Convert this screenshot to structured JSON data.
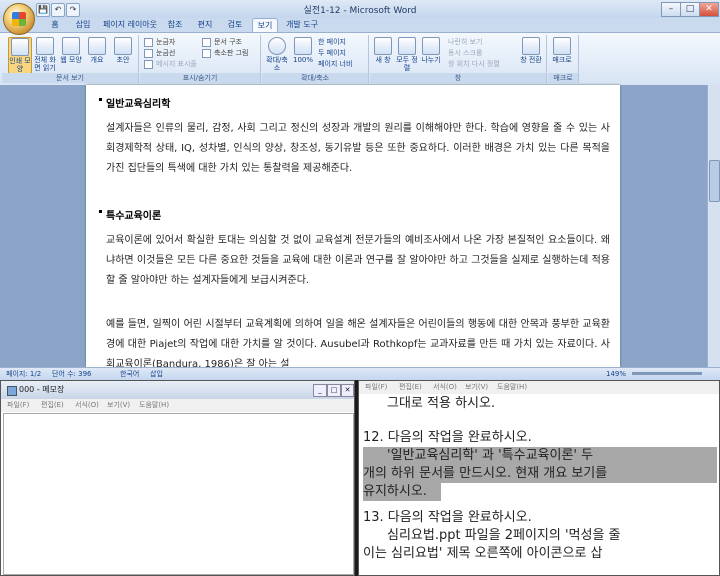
{
  "word": {
    "title": "실전1-12 - Microsoft Word",
    "qat": [
      "💾",
      "↶",
      "↷"
    ],
    "tabs": [
      "홈",
      "삽입",
      "페이지 레이아웃",
      "참조",
      "편지",
      "검토",
      "보기",
      "개발 도구"
    ],
    "active_tab": "보기",
    "ribbon": {
      "doc_views": {
        "label": "문서 보기",
        "buttons": [
          "인쇄 모양",
          "전체 화면 읽기",
          "웹 모양",
          "개요",
          "초안"
        ]
      },
      "show_hide": {
        "label": "표시/숨기기",
        "items": [
          "눈금자",
          "눈금선",
          "메시지 표시줄",
          "문서 구조",
          "축소판 그림"
        ]
      },
      "zoom": {
        "label": "확대/축소",
        "buttons": [
          "확대/축소",
          "100%"
        ],
        "items": [
          "한 페이지",
          "두 페이지",
          "페이지 너비"
        ]
      },
      "window": {
        "label": "창",
        "buttons": [
          "새 창",
          "모두 정렬",
          "나누기"
        ],
        "items": [
          "나란히 보기",
          "동시 스크롤",
          "창 위치 다시 정렬"
        ],
        "switch": "창 전환"
      },
      "macro": {
        "label": "매크로",
        "button": "매크로"
      }
    },
    "document": {
      "heading1": "일반교육심리학",
      "para1": "설계자들은 인류의 물리, 감정, 사회 그리고 정신의 성장과 개발의 원리를 이해해야만 한다. 학습에 영향을 줄 수 있는 사회경제학적 상태, IQ, 성차별, 인식의 양상, 창조성, 동기유발 등은 또한 중요하다. 이러한 배경은 가치 있는 다른 목적을 가진 집단들의 특색에 대한 가치 있는 통찰력을 제공해준다.",
      "heading2": "특수교육이론",
      "para2": "교육이론에 있어서 확실한 토대는 의심할 것 없이 교육설계 전문가들의 예비조사에서 나온 가장 본질적인 요소들이다. 왜냐하면 이것들은 모든 다른 중요한 것들을 교육에 대한 이론과 연구를 잘 알아야만 하고 그것들을 실제로 실행하는데 적용할 줄 알아야만 하는 설계자들에게 보급시켜준다.",
      "para3": "예를 들면, 일찍이 어린 시절부터 교육계획에 의하여 일을 해온 설계자들은 어린이들의 행동에 대한 안목과 풍부한 교육환경에 대한 Piajet의 작업에 대한 가치를 알 것이다. Ausubel과 Rothkopf는 교과자료를 만든 때 가치 있는 자료이다. 사회교육이론(Bandura, 1986)은 잘 아는 설"
    },
    "status": {
      "page": "페이지: 1/2",
      "words": "단어 수: 396",
      "lang": "한국어",
      "mode": "삽입",
      "zoom": "149%"
    }
  },
  "notepad_left": {
    "title": "000 - 메모장",
    "menu": [
      "파일(F)",
      "편집(E)",
      "서식(O)",
      "보기(V)",
      "도움말(H)"
    ]
  },
  "notepad_right": {
    "menu": [
      "파일(F)",
      "편집(E)",
      "서식(O)",
      "보기(V)",
      "도움말(H)"
    ],
    "lines": [
      "그대로 적용 하시오.",
      "",
      "12. 다음의 작업을 완료하시오.",
      "'일반교육심리학' 과 '특수교육이론' 두",
      "개의 하위 문서를 만드시오. 현재 개요 보기를",
      "유지하시오.",
      "",
      "13. 다음의 작업을 완료하시오.",
      "심리요법.ppt 파일을 2페이지의 '먹성을 줄",
      "이는 심리요법' 제목 오른쪽에 아이콘으로 삽"
    ]
  }
}
